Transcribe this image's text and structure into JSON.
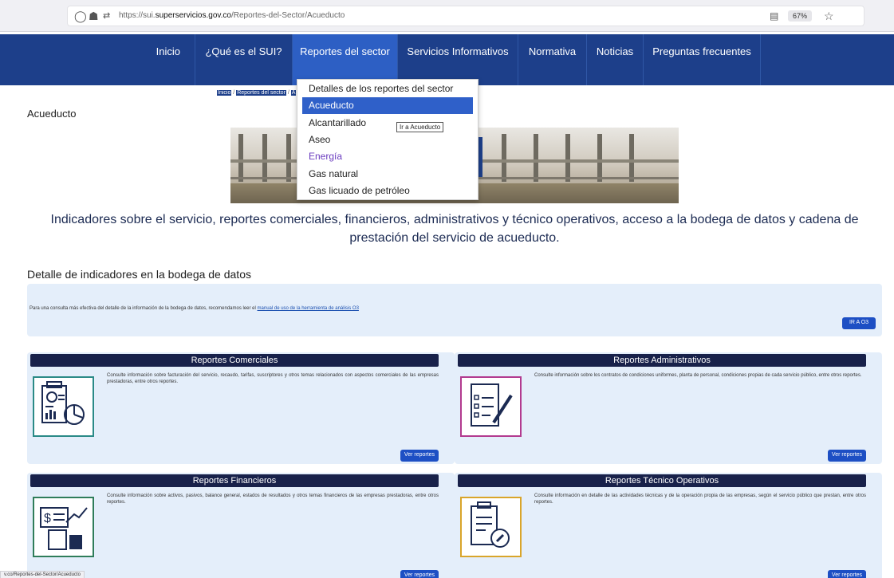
{
  "browser": {
    "url_prefix": "https://sui.",
    "url_domain": "superservicios.gov.co",
    "url_path": "/Reportes-del-Sector/Acueducto",
    "zoom": "67%"
  },
  "nav": {
    "items": [
      {
        "label": "Inicio"
      },
      {
        "label": "¿Qué es el SUI?"
      },
      {
        "label": "Reportes del sector"
      },
      {
        "label": "Servicios Informativos"
      },
      {
        "label": "Normativa"
      },
      {
        "label": "Noticias"
      },
      {
        "label": "Preguntas frecuentes"
      }
    ]
  },
  "dropdown": {
    "items": [
      {
        "label": "Detalles de los reportes del sector"
      },
      {
        "label": "Acueducto"
      },
      {
        "label": "Alcantarillado"
      },
      {
        "label": "Aseo"
      },
      {
        "label": "Energía"
      },
      {
        "label": "Gas natural"
      },
      {
        "label": "Gas licuado de petróleo"
      }
    ],
    "tooltip": "Ir a Acueducto"
  },
  "breadcrumb": {
    "home": "Inicio",
    "sep": "/",
    "section": "Reportes del sector",
    "sep2": "/",
    "current": "A"
  },
  "page": {
    "title": "Acueducto",
    "subtitle": "Indicadores sobre el servicio, reportes comerciales, financieros, administrativos y técnico operativos, acceso a la bodega de datos y cadena de prestación del servicio de acueducto."
  },
  "warehouse": {
    "title": "Detalle de indicadores en la bodega de datos",
    "text": "Para una consulta más efectiva del detalle de la información de la bodega de datos, recomendamos leer el ",
    "link": "manual de uso de la herramienta de análisis O3",
    "button": "IR A O3"
  },
  "cards": [
    {
      "title": "Reportes Comerciales",
      "text": "Consulte información sobre facturación del servicio, recaudo, tarifas, suscriptores y otros temas relacionados con aspectos comerciales de las empresas prestadoras, entre otros reportes.",
      "button": "Ver reportes",
      "icon": "commercial-report-icon"
    },
    {
      "title": "Reportes Administrativos",
      "text": "Consulte información sobre los contratos de condiciones uniformes, planta de personal, condiciones propias de cada servicio público, entre otros reportes.",
      "button": "Ver reportes",
      "icon": "administrative-report-icon"
    },
    {
      "title": "Reportes Financieros",
      "text": "Consulte información sobre activos, pasivos, balance general, estados de resultados y otros temas financieros de las empresas prestadoras, entre otros reportes.",
      "button": "Ver reportes",
      "icon": "financial-report-icon"
    },
    {
      "title": "Reportes Técnico Operativos",
      "text": "Consulte información en detalle de las actividades técnicas y de la operación propia de las empresas, según el servicio público que prestan, entre otros reportes.",
      "button": "Ver reportes",
      "icon": "technical-report-icon"
    }
  ],
  "statusbar": {
    "text": "v.co/Reportes-del-Sector/Acueducto"
  },
  "colors": {
    "nav": "#1d3f8a",
    "nav_active": "#2d5fc4",
    "card_head": "#18214a",
    "card_bg": "#e4eefa",
    "button": "#1d4fc4"
  }
}
